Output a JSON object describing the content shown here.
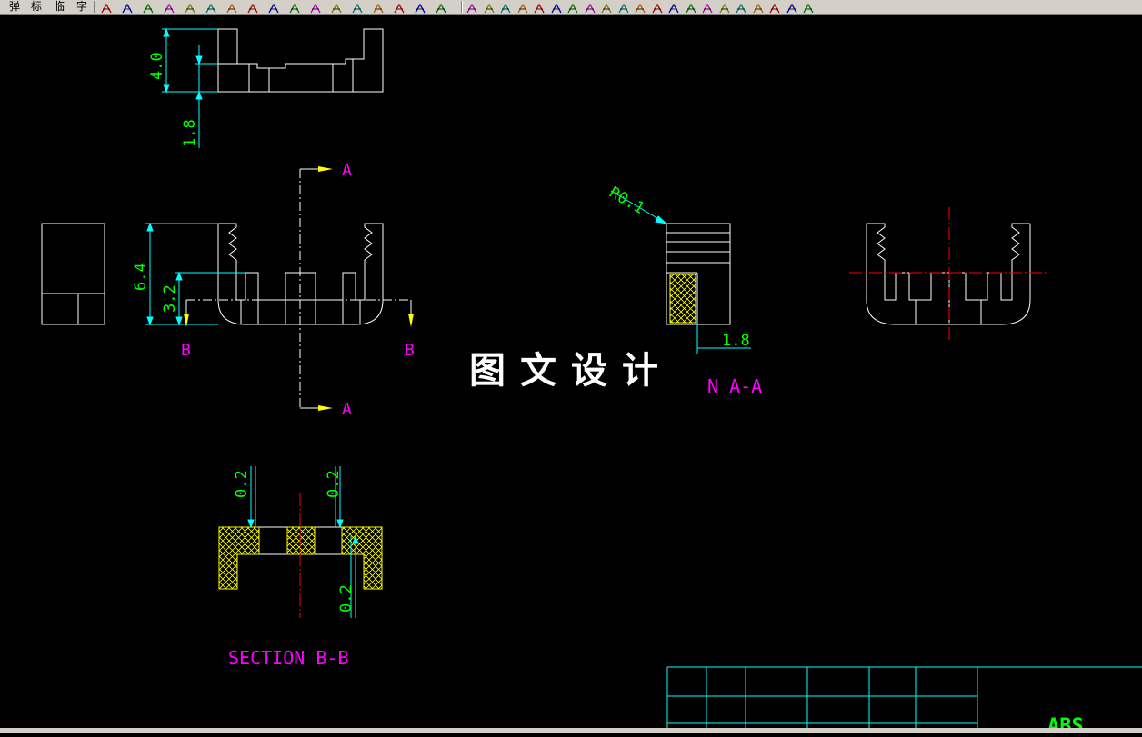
{
  "toolbar": {
    "menu_chars": [
      "弹",
      "标",
      "临",
      "字"
    ],
    "icons": [
      "hatch-icon",
      "weld-icon",
      "surface-icon",
      "center-line-icon",
      "balloon-icon",
      "list-icon",
      "screw-icon",
      "fastener-icon",
      "spring-icon",
      "bearing-icon",
      "section-icon",
      "roughness-icon",
      "datum-icon",
      "tolerance-icon",
      "arc-icon",
      "line-icon",
      "perp-icon",
      "angle-icon",
      "arrow-icon",
      "tag-icon",
      "curve-icon",
      "break-icon",
      "dimension-icon",
      "chamfer-icon",
      "radius-icon",
      "leader-icon",
      "length-icon",
      "hole-icon",
      "scale-icon",
      "spline-icon",
      "offset-icon",
      "point-icon",
      "corner-icon",
      "table-icon",
      "move-icon",
      "arrow-left-right-icon",
      "arrow-up-down-icon",
      "fit-icon"
    ]
  },
  "drawing": {
    "dim_top_height": "4.0",
    "dim_top_offset": "1.8",
    "dim_front_height": "6.4",
    "dim_front_inner": "3.2",
    "section_mark_a_top": "A",
    "section_mark_a_bottom": "A",
    "section_mark_b_left": "B",
    "section_mark_b_right": "B",
    "dim_radius": "R0.1",
    "dim_side_offset": "1.8",
    "view_label_a": "N A-A",
    "dim_bb_left": "0.2",
    "dim_bb_right": "0.2",
    "dim_bb_side": "0.2",
    "view_label_b": "SECTION B-B",
    "material": "ABS"
  },
  "watermark": "图文设计",
  "colors": {
    "background": "#000000",
    "geometry": "#ffffff",
    "dimension_line": "#00ffff",
    "dimension_text": "#00ff00",
    "label": "#ff00ff",
    "center_line": "#ff0000",
    "hatch": "#ffff00",
    "title_block": "#00ffff"
  }
}
